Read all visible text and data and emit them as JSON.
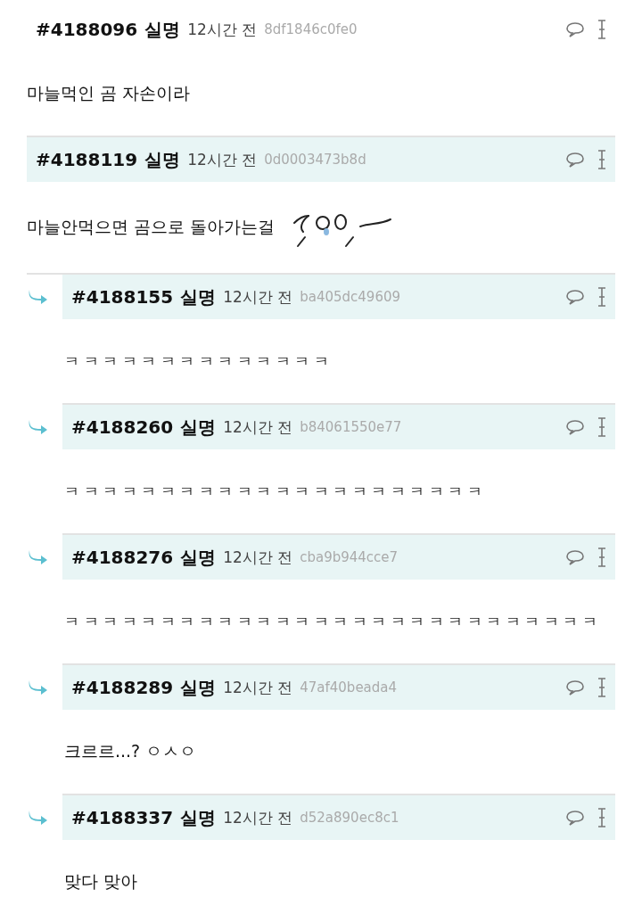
{
  "comments": [
    {
      "kind": "root",
      "highlighted": false,
      "number": "#4188096",
      "author": "실명",
      "time": "12시간 전",
      "hash": "8df1846c0fe0",
      "body": "마늘먹인 곰 자손이라",
      "sticker": false
    },
    {
      "kind": "root",
      "highlighted": true,
      "number": "#4188119",
      "author": "실명",
      "time": "12시간 전",
      "hash": "0d0003473b8d",
      "body": "마늘안먹으면 곰으로 돌아가는걸",
      "sticker": true
    },
    {
      "kind": "reply",
      "highlighted": true,
      "number": "#4188155",
      "author": "실명",
      "time": "12시간 전",
      "hash": "ba405dc49609",
      "body": "ㅋㅋㅋㅋㅋㅋㅋㅋㅋㅋㅋㅋㅋㅋ",
      "sticker": false
    },
    {
      "kind": "reply",
      "highlighted": true,
      "number": "#4188260",
      "author": "실명",
      "time": "12시간 전",
      "hash": "b84061550e77",
      "body": "ㅋㅋㅋㅋㅋㅋㅋㅋㅋㅋㅋㅋㅋㅋㅋㅋㅋㅋㅋㅋㅋㅋ",
      "sticker": false
    },
    {
      "kind": "reply",
      "highlighted": true,
      "number": "#4188276",
      "author": "실명",
      "time": "12시간 전",
      "hash": "cba9b944cce7",
      "body": "ㅋㅋㅋㅋㅋㅋㅋㅋㅋㅋㅋㅋㅋㅋㅋㅋㅋㅋㅋㅋㅋㅋㅋㅋㅋㅋㅋㅋ",
      "sticker": false
    },
    {
      "kind": "reply",
      "highlighted": true,
      "number": "#4188289",
      "author": "실명",
      "time": "12시간 전",
      "hash": "47af40beada4",
      "body": "크르르...? ㅇㅅㅇ",
      "sticker": false
    },
    {
      "kind": "reply",
      "highlighted": true,
      "number": "#4188337",
      "author": "실명",
      "time": "12시간 전",
      "hash": "d52a890ec8c1",
      "body": "맞다 맞아",
      "sticker": false
    }
  ]
}
